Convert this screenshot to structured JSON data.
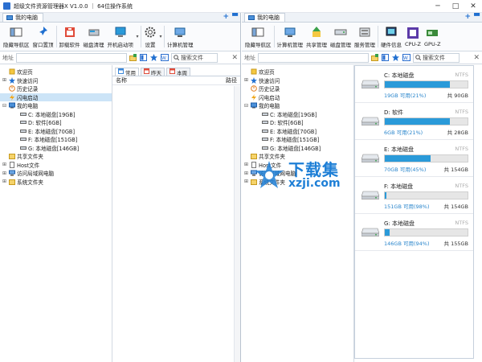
{
  "window": {
    "title": "超级文件资源管理器X V1.0.0 ｜ 64位操作系统",
    "controls": {
      "minimize": "─",
      "maximize": "□",
      "close": "✕"
    }
  },
  "left": {
    "tab_title": "我的电脑",
    "ribbon": [
      {
        "label": "隐藏导航区",
        "icon": "hide-nav-icon"
      },
      {
        "label": "窗口置顶",
        "icon": "pin-icon"
      },
      {
        "label": "卸载软件",
        "icon": "uninstall-icon"
      },
      {
        "label": "磁盘清理",
        "icon": "disk-clean-icon"
      },
      {
        "label": "开机启动项",
        "icon": "startup-icon"
      },
      {
        "label": "设置",
        "icon": "gear-icon"
      },
      {
        "label": "计算机管理",
        "icon": "computer-manage-icon"
      }
    ],
    "address_label": "地址",
    "search_placeholder": "搜索文件",
    "tree": [
      {
        "label": "欢迎页",
        "icon": "home-icon",
        "indent": 0,
        "expander": ""
      },
      {
        "label": "快速访问",
        "icon": "star-icon",
        "indent": 0,
        "expander": "⊞"
      },
      {
        "label": "历史记录",
        "icon": "history-icon",
        "indent": 0,
        "expander": ""
      },
      {
        "label": "闪电启动",
        "icon": "lightning-icon",
        "indent": 0,
        "expander": "",
        "selected": true
      },
      {
        "label": "我的电脑",
        "icon": "computer-icon",
        "indent": 0,
        "expander": "⊟"
      },
      {
        "label": "C: 本地磁盘[19GB]",
        "icon": "drive-icon",
        "indent": 1,
        "expander": ""
      },
      {
        "label": "D: 软件[6GB]",
        "icon": "drive-icon",
        "indent": 1,
        "expander": ""
      },
      {
        "label": "E: 本地磁盘[70GB]",
        "icon": "drive-icon",
        "indent": 1,
        "expander": ""
      },
      {
        "label": "F: 本地磁盘[151GB]",
        "icon": "drive-icon",
        "indent": 1,
        "expander": ""
      },
      {
        "label": "G: 本地磁盘[146GB]",
        "icon": "drive-icon",
        "indent": 1,
        "expander": ""
      },
      {
        "label": "共享文件夹",
        "icon": "folder-icon",
        "indent": 0,
        "expander": ""
      },
      {
        "label": "Host文件",
        "icon": "file-icon",
        "indent": 0,
        "expander": "⊞"
      },
      {
        "label": "访问局域网电脑",
        "icon": "network-icon",
        "indent": 0,
        "expander": "⊞"
      },
      {
        "label": "系统文件夹",
        "icon": "folder-icon",
        "indent": 0,
        "expander": "⊞"
      }
    ],
    "file_tabs": [
      {
        "label": "常用",
        "active": true
      },
      {
        "label": "昨天",
        "active": false
      },
      {
        "label": "本周",
        "active": false
      }
    ],
    "columns": {
      "name": "名称",
      "path": "路径"
    }
  },
  "right": {
    "tab_title": "我的电脑",
    "ribbon": [
      {
        "label": "隐藏导航区",
        "icon": "hide-nav-icon"
      },
      {
        "label": "计算机管理",
        "icon": "computer-manage-icon"
      },
      {
        "label": "共享管理",
        "icon": "share-manage-icon"
      },
      {
        "label": "磁盘管理",
        "icon": "disk-manage-icon"
      },
      {
        "label": "服务管理",
        "icon": "service-manage-icon"
      },
      {
        "label": "硬件信息",
        "icon": "hardware-info-icon"
      },
      {
        "label": "CPU-Z",
        "icon": "cpuz-icon"
      },
      {
        "label": "GPU-Z",
        "icon": "gpuz-icon"
      }
    ],
    "address_label": "地址",
    "search_placeholder": "搜索文件",
    "tree": [
      {
        "label": "欢迎页",
        "icon": "home-icon",
        "indent": 0,
        "expander": ""
      },
      {
        "label": "快速访问",
        "icon": "star-icon",
        "indent": 0,
        "expander": "⊞"
      },
      {
        "label": "历史记录",
        "icon": "history-icon",
        "indent": 0,
        "expander": ""
      },
      {
        "label": "闪电启动",
        "icon": "lightning-icon",
        "indent": 0,
        "expander": ""
      },
      {
        "label": "我的电脑",
        "icon": "computer-icon",
        "indent": 0,
        "expander": "⊟"
      },
      {
        "label": "C: 本地磁盘[19GB]",
        "icon": "drive-icon",
        "indent": 1,
        "expander": ""
      },
      {
        "label": "D: 软件[6GB]",
        "icon": "drive-icon",
        "indent": 1,
        "expander": ""
      },
      {
        "label": "E: 本地磁盘[70GB]",
        "icon": "drive-icon",
        "indent": 1,
        "expander": ""
      },
      {
        "label": "F: 本地磁盘[151GB]",
        "icon": "drive-icon",
        "indent": 1,
        "expander": ""
      },
      {
        "label": "G: 本地磁盘[146GB]",
        "icon": "drive-icon",
        "indent": 1,
        "expander": ""
      },
      {
        "label": "共享文件夹",
        "icon": "folder-icon",
        "indent": 0,
        "expander": ""
      },
      {
        "label": "Host文件",
        "icon": "file-icon",
        "indent": 0,
        "expander": "⊞"
      },
      {
        "label": "访问局域网电脑",
        "icon": "network-icon",
        "indent": 0,
        "expander": "⊞"
      },
      {
        "label": "系统文件夹",
        "icon": "folder-icon",
        "indent": 0,
        "expander": "⊞"
      }
    ],
    "drives": [
      {
        "name": "C: 本地磁盘",
        "fs": "NTFS",
        "free": "19GB 可用(21%)",
        "total": "共 90GB",
        "used_fraction": 0.79
      },
      {
        "name": "D: 软件",
        "fs": "NTFS",
        "free": "6GB 可用(21%)",
        "total": "共 28GB",
        "used_fraction": 0.79
      },
      {
        "name": "E: 本地磁盘",
        "fs": "NTFS",
        "free": "70GB 可用(45%)",
        "total": "共 154GB",
        "used_fraction": 0.55
      },
      {
        "name": "F: 本地磁盘",
        "fs": "NTFS",
        "free": "151GB 可用(98%)",
        "total": "共 154GB",
        "used_fraction": 0.02
      },
      {
        "name": "G: 本地磁盘",
        "fs": "NTFS",
        "free": "146GB 可用(94%)",
        "total": "共 155GB",
        "used_fraction": 0.06
      }
    ]
  },
  "watermark": {
    "cn": "下载集",
    "en": "xzji.com"
  },
  "colors": {
    "accent": "#2a9ad9",
    "selection": "#cce4f7",
    "free_text": "#2a86cc"
  }
}
